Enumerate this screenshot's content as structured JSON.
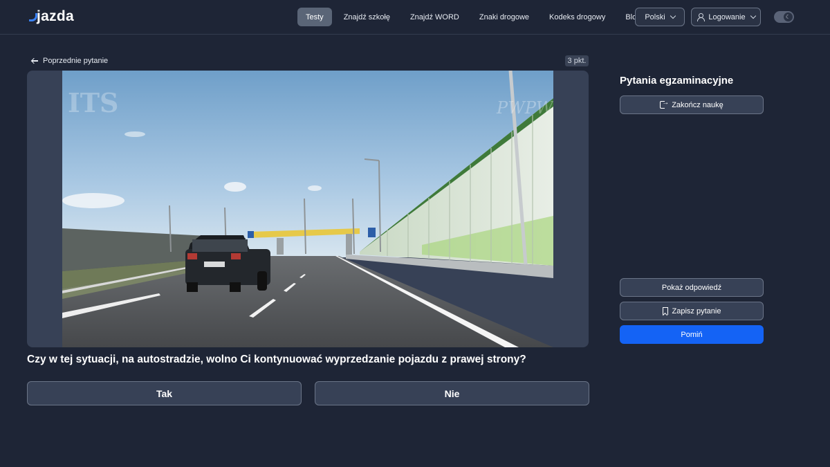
{
  "header": {
    "logo": "jazda",
    "nav": [
      {
        "label": "Testy",
        "active": true
      },
      {
        "label": "Znajdź szkołę",
        "active": false
      },
      {
        "label": "Znajdź WORD",
        "active": false
      },
      {
        "label": "Znaki drogowe",
        "active": false
      },
      {
        "label": "Kodeks drogowy",
        "active": false
      },
      {
        "label": "Blog",
        "active": false
      }
    ],
    "language": "Polski",
    "login": "Logowanie",
    "theme_toggle_icon": "moon-icon"
  },
  "question": {
    "back_label": "Poprzednie pytanie",
    "points": "3 pkt.",
    "image_watermarks": [
      "ITS",
      "PWPW"
    ],
    "text": "Czy w tej sytuacji, na autostradzie, wolno Ci kontynuować wyprzedzanie pojazdu z prawej strony?",
    "answers": [
      "Tak",
      "Nie"
    ]
  },
  "sidebar": {
    "title": "Pytania egzaminacyjne",
    "end_label": "Zakończ naukę",
    "show_answer_label": "Pokaż odpowiedź",
    "save_label": "Zapisz pytanie",
    "skip_label": "Pomiń"
  },
  "colors": {
    "background": "#1e2536",
    "primary": "#1463f5",
    "surface": "#374156",
    "logo_accent": "#3b82f6"
  }
}
